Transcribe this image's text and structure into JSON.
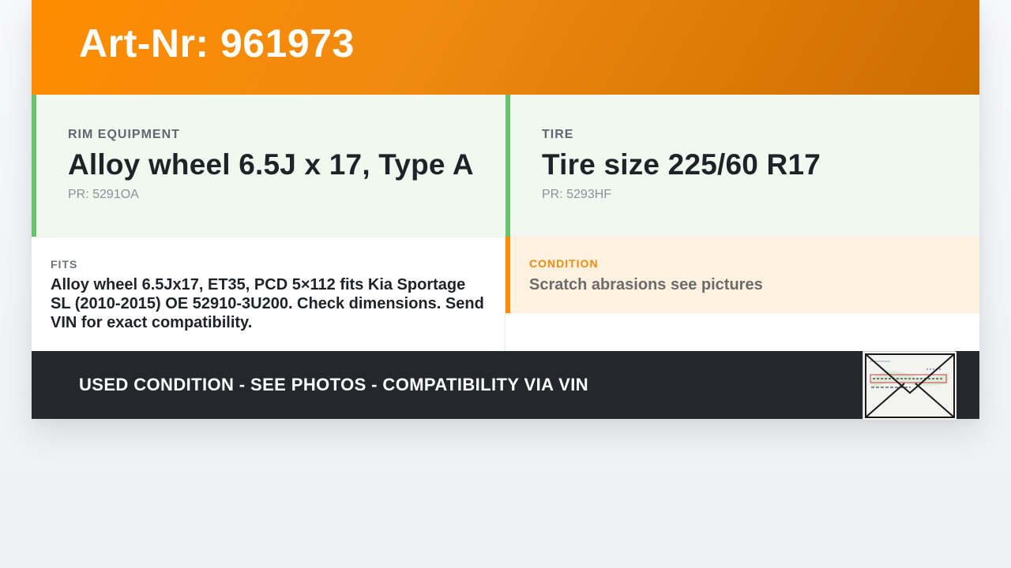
{
  "header": {
    "title": "Art-Nr: 961973"
  },
  "rim": {
    "label": "RIM EQUIPMENT",
    "value": "Alloy wheel 6.5J x 17, Type A",
    "pr": "PR: 5291OA"
  },
  "tire": {
    "label": "TIRE",
    "value": "Tire size 225/60 R17",
    "pr": "PR: 5293HF"
  },
  "fits": {
    "label": "FITS",
    "text": "Alloy wheel 6.5Jx17, ET35, PCD 5×112 fits Kia Sportage SL (2010-2015) OE 52910-3U200. Check dimensions. Send VIN for exact compatibility."
  },
  "condition": {
    "label": "CONDITION",
    "text": "Scratch abrasions see pictures"
  },
  "footer": {
    "banner": "USED CONDITION - SEE PHOTOS - COMPATIBILITY VIA VIN",
    "thumbnail_icon": "vehicle-document-thumbnail-icon"
  },
  "colors": {
    "accent_orange": "#ff8c00",
    "spec_green": "#68c46c",
    "footer_dark": "#24272c"
  }
}
